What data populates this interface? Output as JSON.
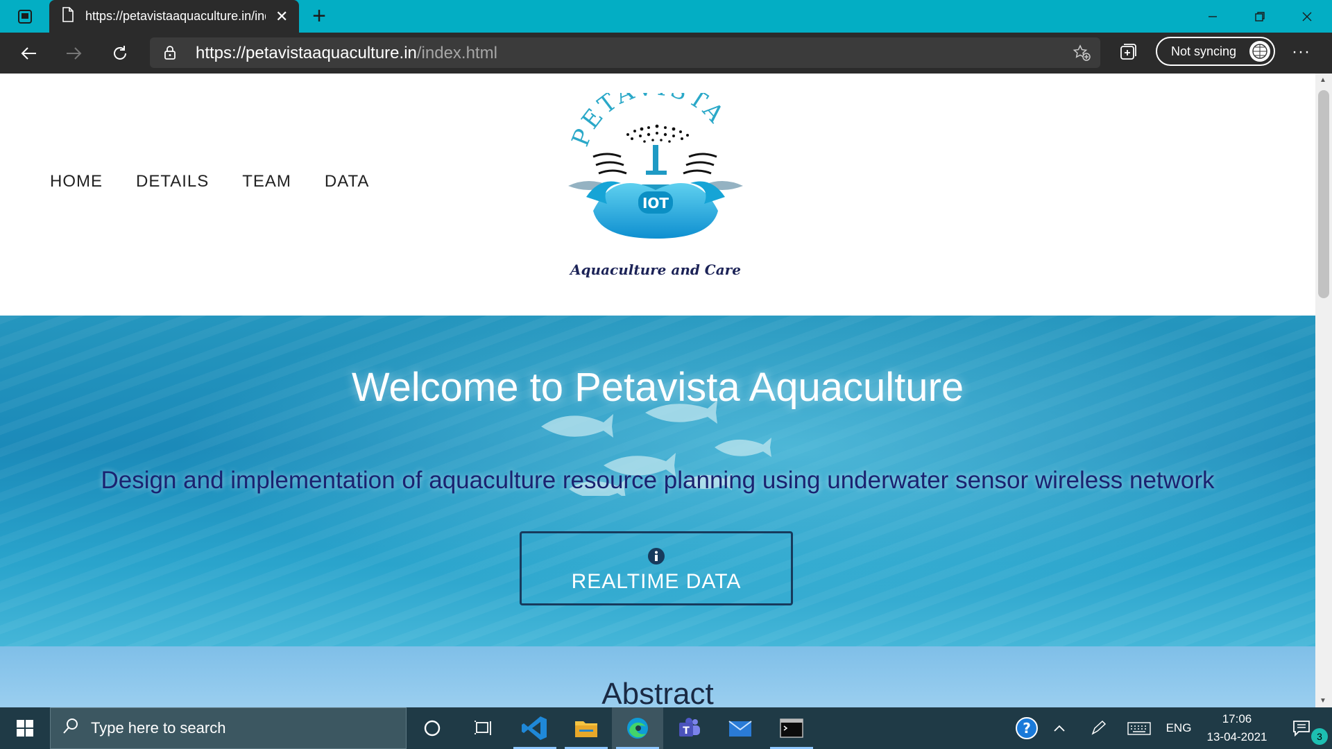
{
  "browser": {
    "tab_title": "https://petavistaaquaculture.in/index.html",
    "url_host": "https://petavistaaquaculture.in",
    "url_path": "/index.html",
    "profile_label": "Not syncing",
    "more_label": "···"
  },
  "site": {
    "nav": [
      "HOME",
      "DETAILS",
      "TEAM",
      "DATA"
    ],
    "logo": {
      "arc_text": "PETAVISTA",
      "badge_text": "IOT",
      "tagline": "Aquaculture and Care"
    },
    "hero": {
      "title": "Welcome to Petavista Aquaculture",
      "subtitle": "Design and implementation of aquaculture resource planning using underwater sensor wireless network",
      "button_label": "REALTIME DATA"
    },
    "abstract_heading": "Abstract"
  },
  "taskbar": {
    "search_placeholder": "Type here to search",
    "language": "ENG",
    "time": "17:06",
    "date": "13-04-2021",
    "notification_count": "3"
  },
  "colors": {
    "titlebar": "#03aec4",
    "toolbar": "#2b2b2b",
    "taskbar": "#1f3a46",
    "hero_subtitle": "#1a2270"
  }
}
